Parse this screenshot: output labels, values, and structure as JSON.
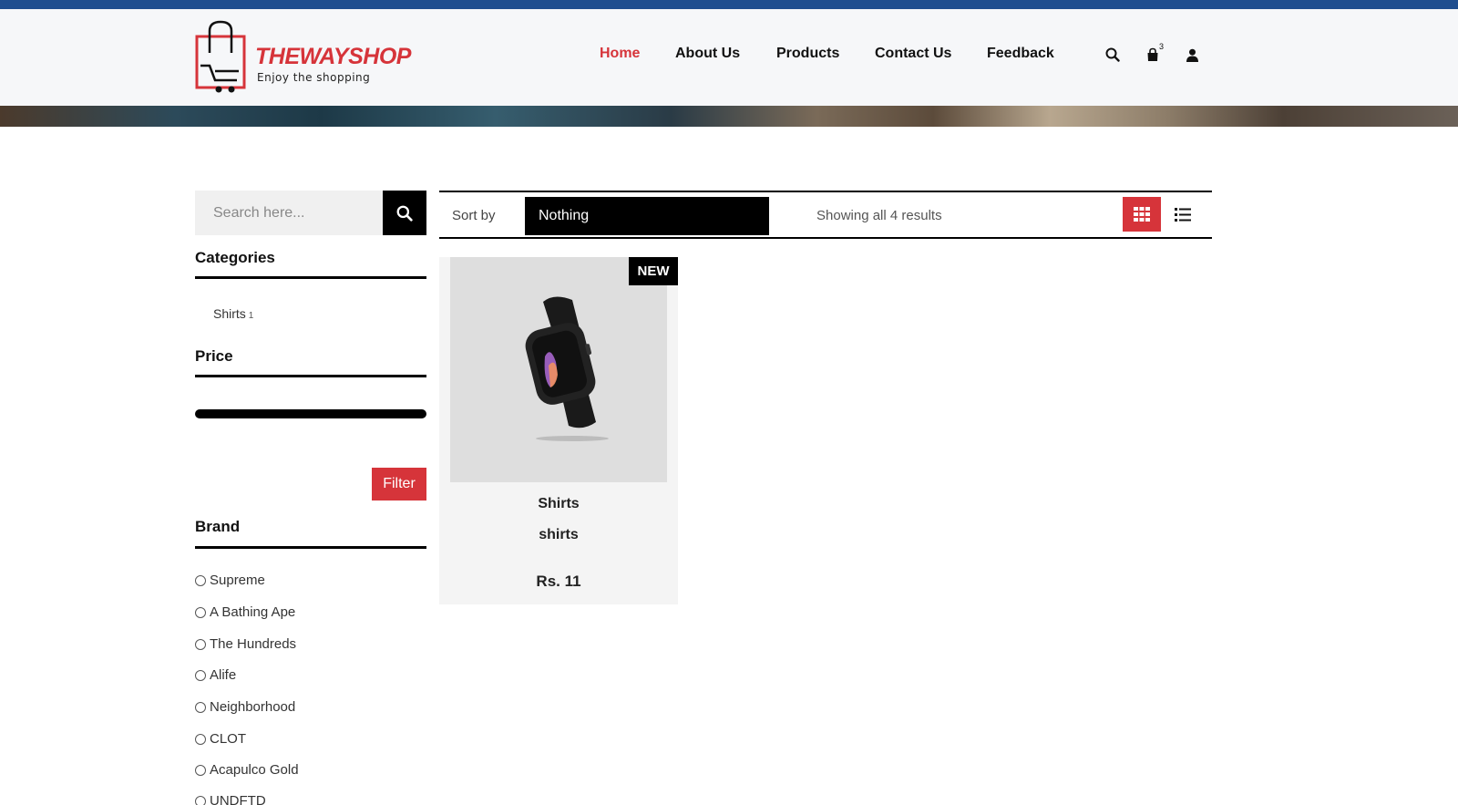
{
  "brand": {
    "name": "THEWAYSHOP",
    "tagline": "Enjoy the shopping",
    "accent_color": "#d6343a",
    "topbar_color": "#1f4e8f"
  },
  "nav": {
    "items": [
      {
        "label": "Home",
        "active": true
      },
      {
        "label": "About Us"
      },
      {
        "label": "Products"
      },
      {
        "label": "Contact Us"
      },
      {
        "label": "Feedback"
      }
    ]
  },
  "header_icons": {
    "search": "search-icon",
    "cart": "shopping-bag-icon",
    "cart_count": "3",
    "user": "user-icon"
  },
  "sidebar": {
    "search_placeholder": "Search here...",
    "categories_heading": "Categories",
    "categories": [
      {
        "label": "Shirts",
        "count": "1"
      }
    ],
    "price_heading": "Price",
    "filter_label": "Filter",
    "brand_heading": "Brand",
    "brands": [
      "Supreme",
      "A Bathing Ape",
      "The Hundreds",
      "Alife",
      "Neighborhood",
      "CLOT",
      "Acapulco Gold",
      "UNDFTD"
    ]
  },
  "toolbar": {
    "sort_label": "Sort by",
    "sort_value": "Nothing",
    "results_text": "Showing all 4 results",
    "grid_view": "grid-view-icon",
    "list_view": "list-view-icon"
  },
  "products": [
    {
      "badge": "NEW",
      "category": "Shirts",
      "name": "shirts",
      "price": "Rs. 11"
    }
  ]
}
